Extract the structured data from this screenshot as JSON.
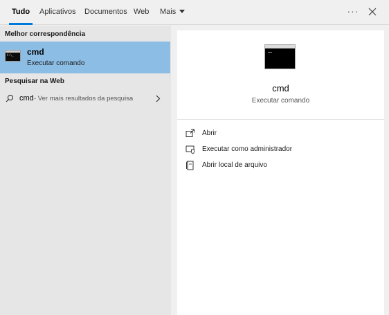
{
  "tabs": {
    "all": "Tudo",
    "apps": "Aplicativos",
    "documents": "Documentos",
    "web": "Web",
    "more": "Mais"
  },
  "toolbar": {
    "ellipsis": "···"
  },
  "left": {
    "best_match_header": "Melhor correspondência",
    "best_match": {
      "title": "cmd",
      "subtitle": "Executar comando",
      "icon": "command-prompt-icon"
    },
    "web_header": "Pesquisar na Web",
    "web_result": {
      "query": "cmd",
      "hint": "- Ver mais resultados da pesquisa"
    }
  },
  "preview": {
    "title": "cmd",
    "subtitle": "Executar comando",
    "icon": "command-prompt-icon",
    "actions": [
      {
        "label": "Abrir",
        "icon": "open-icon"
      },
      {
        "label": "Executar como administrador",
        "icon": "run-as-admin-icon"
      },
      {
        "label": "Abrir local de arquivo",
        "icon": "file-location-icon"
      }
    ]
  },
  "colors": {
    "accent": "#0078d7",
    "selected": "#8cbde5",
    "left_bg": "#e6e6e6",
    "top_bg": "#f0f0f0",
    "panel_bg": "#ffffff"
  }
}
